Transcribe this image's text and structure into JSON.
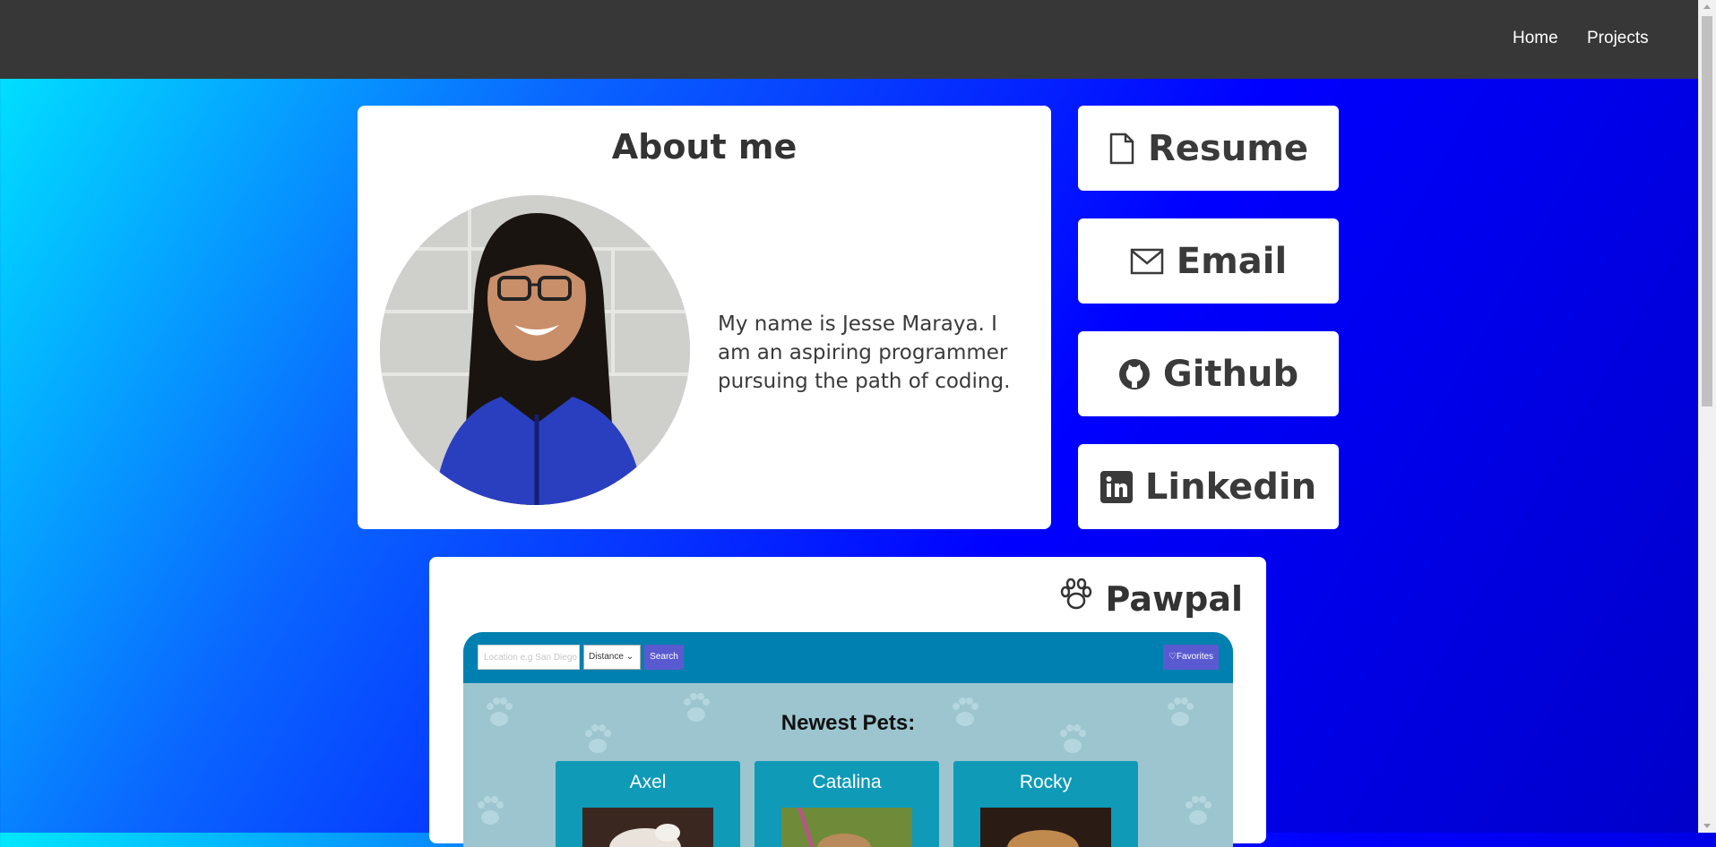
{
  "nav": {
    "links": [
      "Home",
      "Projects"
    ]
  },
  "about": {
    "title": "About me",
    "text": "My name is Jesse Maraya. I am an aspiring programmer pursuing the path of coding."
  },
  "links": {
    "resume": "Resume",
    "email": "Email",
    "github": "Github",
    "linkedin": "Linkedin"
  },
  "project": {
    "title": "Pawpal",
    "preview": {
      "location_placeholder": "Location e.g San Diego",
      "distance_label": "Distance",
      "search_label": "Search",
      "favorites_label": "Favorites",
      "heading": "Newest Pets:",
      "pets": [
        "Axel",
        "Catalina",
        "Rocky"
      ]
    }
  },
  "colors": {
    "navbar": "#373737",
    "card": "#ffffff",
    "text": "#333333",
    "preview_bar": "#0080b0",
    "pet_card": "#0f9ab8"
  }
}
